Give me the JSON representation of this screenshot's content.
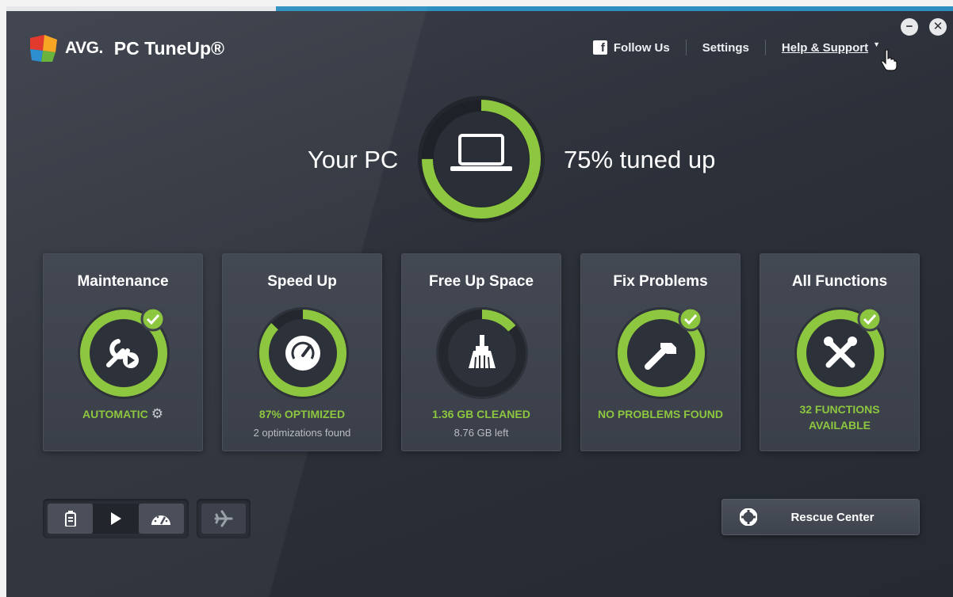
{
  "app": {
    "brand": "AVG.",
    "product": "PC TuneUp®"
  },
  "topnav": {
    "follow_us": "Follow Us",
    "settings": "Settings",
    "help_support": "Help & Support",
    "caret": "▼"
  },
  "window_controls": {
    "minimize": "−",
    "close": "✕"
  },
  "hero": {
    "left_text": "Your PC",
    "right_text": "75% tuned up",
    "progress": 0.75
  },
  "tiles": [
    {
      "title": "Maintenance",
      "status": "AUTOMATIC",
      "sub": "",
      "progress": 1.0,
      "checked": true,
      "icon": "wrench-play-icon"
    },
    {
      "title": "Speed Up",
      "status": "87% OPTIMIZED",
      "sub": "2 optimizations found",
      "progress": 0.87,
      "checked": false,
      "icon": "speedometer-icon"
    },
    {
      "title": "Free Up Space",
      "status": "1.36 GB CLEANED",
      "sub": "8.76 GB left",
      "progress": 0.14,
      "checked": false,
      "icon": "broom-icon"
    },
    {
      "title": "Fix Problems",
      "status": "NO PROBLEMS FOUND",
      "sub": "",
      "progress": 1.0,
      "checked": true,
      "icon": "wrench-icon"
    },
    {
      "title": "All Functions",
      "status_line1": "32 FUNCTIONS",
      "status_line2": "AVAILABLE",
      "sub": "",
      "progress": 1.0,
      "checked": true,
      "icon": "tools-crossed-icon"
    }
  ],
  "bottom": {
    "rescue_center": "Rescue Center"
  },
  "colors": {
    "accent_green": "#8dc63f",
    "ring_green_light": "#a6d85a",
    "ring_green_dark": "#5f9a2b",
    "ring_track": "#252932",
    "title_bar_accent": "#2d8fbf"
  }
}
